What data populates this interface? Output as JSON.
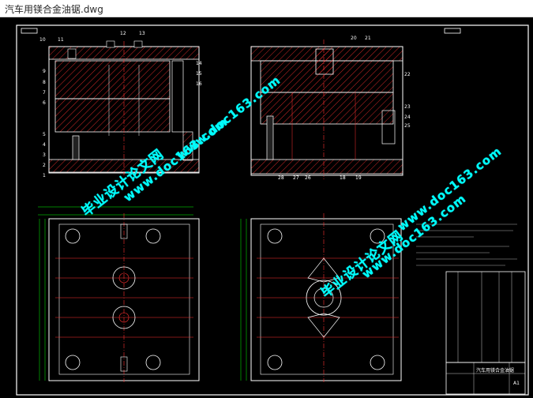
{
  "window": {
    "title": "汽车用镁合金油锯.dwg"
  },
  "watermarks": {
    "cn": "毕业设计论文网",
    "url": "www.doc163.com"
  },
  "balloons_left": [
    "10",
    "11",
    "12",
    "13",
    "14",
    "15",
    "16",
    "9",
    "8",
    "7",
    "6",
    "5",
    "4",
    "3",
    "2",
    "1"
  ],
  "balloons_right": [
    "20",
    "21",
    "22",
    "23",
    "24",
    "25",
    "28",
    "27",
    "26",
    "18",
    "19"
  ],
  "title_block": {
    "label": "汽车用镁合金油锯",
    "scale": "A1"
  },
  "colors": {
    "frame": "#ffffff",
    "hatch": "#ff3030",
    "dims": "#00ff00",
    "outline": "#ffff00",
    "watermark": "#00ffff"
  }
}
